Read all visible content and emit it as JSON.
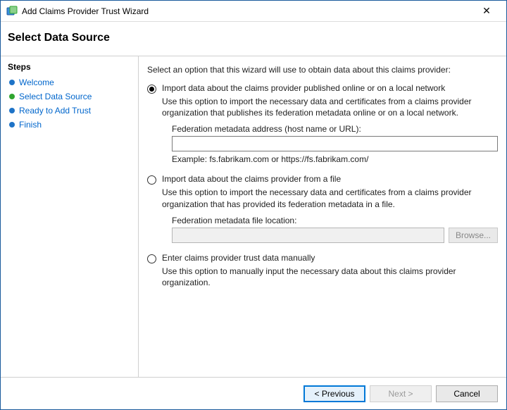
{
  "titlebar": {
    "title": "Add Claims Provider Trust Wizard"
  },
  "header": {
    "title": "Select Data Source"
  },
  "sidebar": {
    "title": "Steps",
    "items": [
      {
        "label": "Welcome",
        "bullet": "blue",
        "current": false
      },
      {
        "label": "Select Data Source",
        "bullet": "green",
        "current": true
      },
      {
        "label": "Ready to Add Trust",
        "bullet": "blue",
        "current": false
      },
      {
        "label": "Finish",
        "bullet": "blue",
        "current": false
      }
    ]
  },
  "content": {
    "intro": "Select an option that this wizard will use to obtain data about this claims provider:",
    "opt1": {
      "title": "Import data about the claims provider published online or on a local network",
      "desc": "Use this option to import the necessary data and certificates from a claims provider organization that publishes its federation metadata online or on a local network.",
      "field_label": "Federation metadata address (host name or URL):",
      "value": "",
      "example": "Example: fs.fabrikam.com or https://fs.fabrikam.com/"
    },
    "opt2": {
      "title": "Import data about the claims provider from a file",
      "desc": "Use this option to import the necessary data and certificates from a claims provider organization that has provided its federation metadata in a file.",
      "field_label": "Federation metadata file location:",
      "value": "",
      "browse_label": "Browse..."
    },
    "opt3": {
      "title": "Enter claims provider trust data manually",
      "desc": "Use this option to manually input the necessary data about this claims provider organization."
    }
  },
  "footer": {
    "previous": "< Previous",
    "next": "Next >",
    "cancel": "Cancel"
  }
}
